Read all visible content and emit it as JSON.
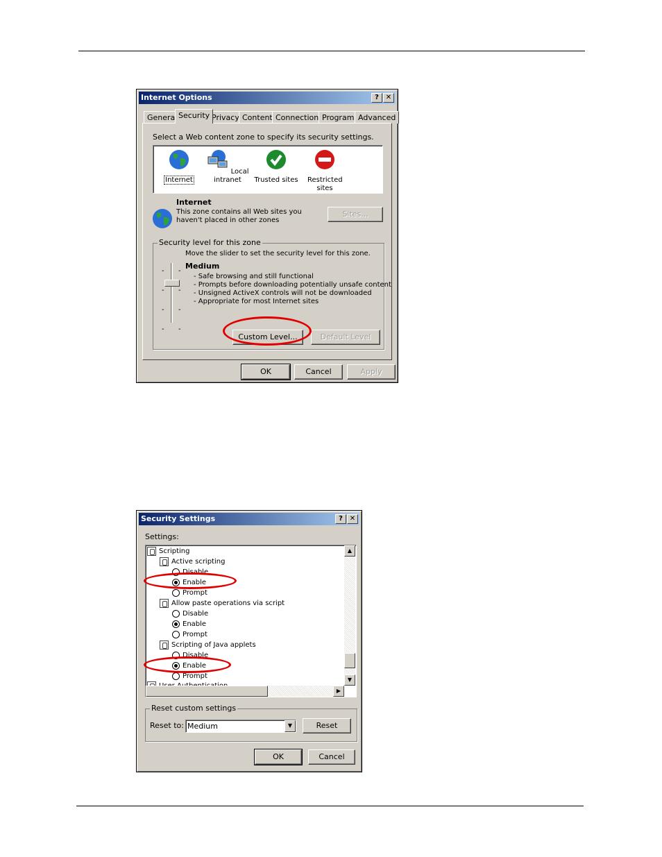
{
  "internet_options": {
    "title": "Internet Options",
    "help_btn": "?",
    "close_btn": "✕",
    "tabs": [
      "General",
      "Security",
      "Privacy",
      "Content",
      "Connections",
      "Programs",
      "Advanced"
    ],
    "instruction": "Select a Web content zone to specify its security settings.",
    "zones": [
      {
        "label": "Internet",
        "icon": "globe-icon"
      },
      {
        "label": "Local intranet",
        "icon": "network-computers-icon"
      },
      {
        "label": "Trusted sites",
        "icon": "checkmark-icon"
      },
      {
        "label": "Restricted sites",
        "icon": "no-entry-icon"
      }
    ],
    "zone_name": "Internet",
    "zone_desc_line1": "This zone contains all Web sites you",
    "zone_desc_line2": "haven't placed in other zones",
    "sites_btn": "Sites...",
    "security_group_label": "Security level for this zone",
    "slider_instruction": "Move the slider to set the security level for this zone.",
    "level_name": "Medium",
    "level_points": [
      "- Safe browsing and still functional",
      "- Prompts before downloading potentially unsafe content",
      "- Unsigned ActiveX controls will not be downloaded",
      "- Appropriate for most Internet sites"
    ],
    "custom_level_btn": "Custom Level...",
    "default_level_btn": "Default Level",
    "ok_btn": "OK",
    "cancel_btn": "Cancel",
    "apply_btn": "Apply"
  },
  "security_settings": {
    "title": "Security Settings",
    "help_btn": "?",
    "close_btn": "✕",
    "settings_label": "Settings:",
    "tree": {
      "scripting": "Scripting",
      "active_scripting": "Active scripting",
      "paste_ops": "Allow paste operations via script",
      "java_applets": "Scripting of Java applets",
      "user_auth": "User Authentication",
      "opt_disable": "Disable",
      "opt_enable": "Enable",
      "opt_prompt": "Prompt"
    },
    "reset_group_label": "Reset custom settings",
    "reset_to_label": "Reset to:",
    "reset_to_value": "Medium",
    "reset_btn": "Reset",
    "ok_btn": "OK",
    "cancel_btn": "Cancel"
  },
  "colors": {
    "highlight": "#e00000",
    "titlebar": "#0a246a"
  }
}
